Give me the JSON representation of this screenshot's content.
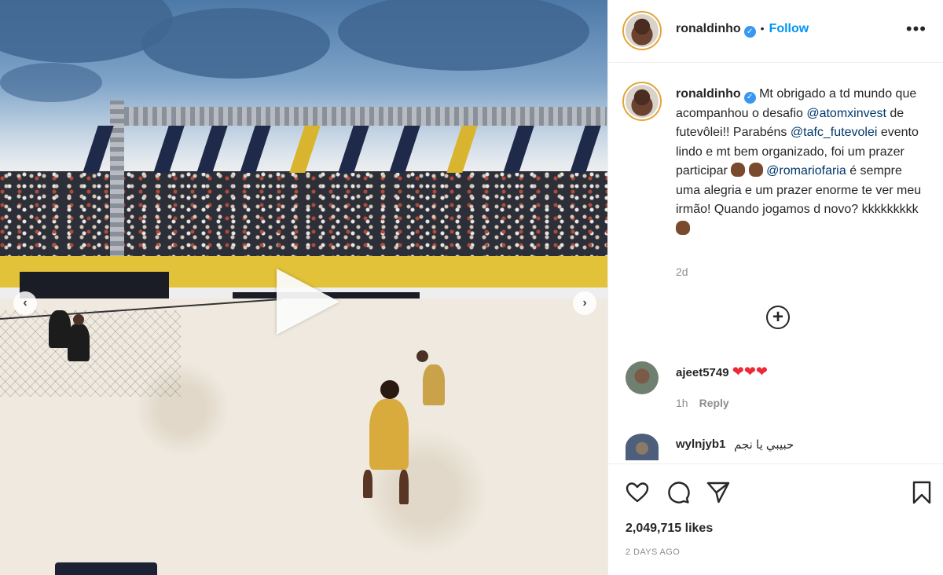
{
  "post": {
    "username": "ronaldinho",
    "follow_label": "Follow",
    "dot": "•",
    "more": "•••",
    "verified_icon": "✓"
  },
  "caption": {
    "username": "ronaldinho",
    "part1": " Mt obrigado a td mundo que acompanhou o desafio ",
    "mention1": "@atomxinvest",
    "part2": " de futevôlei!! Parabéns ",
    "mention2": "@tafc_futevolei",
    "part3": " evento lindo e mt bem organizado, foi um prazer participar ",
    "mention3": "@romariofaria",
    "part4": " é sempre uma alegria e um prazer enorme te ver meu irmão! Quando jogamos d novo? kkkkkkkkk ",
    "time": "2d"
  },
  "load_more": "+",
  "comments": [
    {
      "user": "ajeet5749",
      "text": "❤❤❤",
      "time": "1h",
      "reply": "Reply"
    },
    {
      "user": "wylnjyb1",
      "text": "حبيبي يا نجم"
    }
  ],
  "likes": "2,049,715 likes",
  "date": "2 DAYS AGO",
  "media": {
    "prev": "‹",
    "next": "›"
  },
  "colors": {
    "accent": "#0095f6",
    "mention": "#00376b",
    "verified": "#3897f0",
    "heart": "#ed2939"
  }
}
